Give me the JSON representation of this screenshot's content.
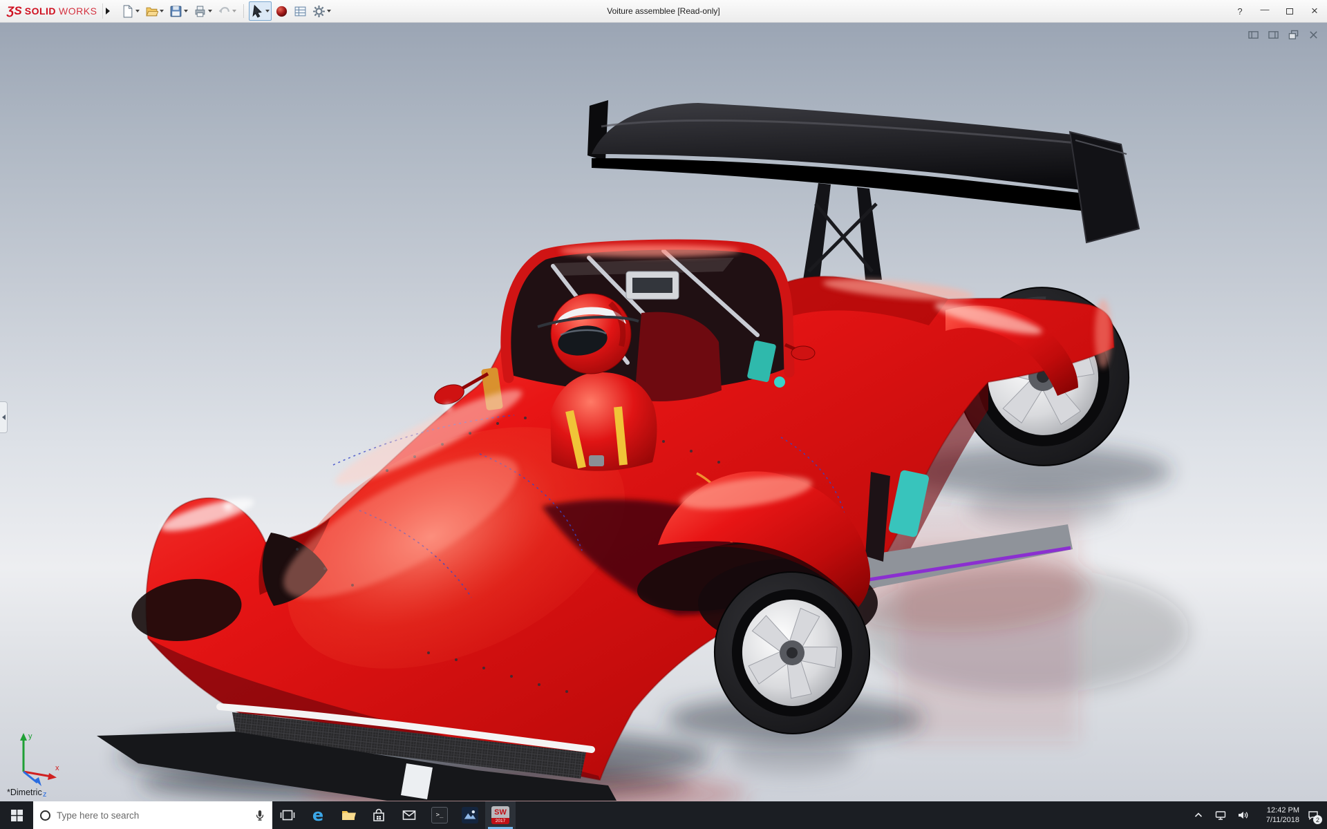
{
  "window": {
    "title": "Voiture assemblee [Read-only]",
    "help": "?",
    "minimize_glyph": "—",
    "close_glyph": "×"
  },
  "brand": {
    "mark": "ƷS",
    "bold": "SOLID",
    "light": "WORKS"
  },
  "toolbar": {
    "icons": [
      {
        "name": "new-document"
      },
      {
        "name": "open-document"
      },
      {
        "name": "save"
      },
      {
        "name": "print"
      },
      {
        "name": "undo"
      },
      {
        "name": "select-arrow",
        "pressed": true
      },
      {
        "name": "appearance-sphere"
      },
      {
        "name": "design-table"
      },
      {
        "name": "options-gear"
      }
    ]
  },
  "viewport": {
    "view_label": "*Dimetric",
    "triad": {
      "x": "x",
      "y": "y",
      "z": "z"
    },
    "model": {
      "body_color": "#e01212",
      "wing_color": "#121216",
      "accent_teal": "#38c4bc",
      "accent_purple": "#8b2fd0",
      "rim_color": "#d7d8dc"
    },
    "corner_icons": [
      {
        "name": "pane-left"
      },
      {
        "name": "pane-right"
      },
      {
        "name": "restore-window"
      },
      {
        "name": "close-window"
      }
    ]
  },
  "taskbar": {
    "search": {
      "placeholder": "Type here to search"
    },
    "apps": [
      {
        "name": "task-view"
      },
      {
        "name": "edge",
        "glyph": "e"
      },
      {
        "name": "file-explorer"
      },
      {
        "name": "store"
      },
      {
        "name": "mail"
      },
      {
        "name": "command-prompt",
        "glyph": "&gt;_"
      },
      {
        "name": "media-app"
      },
      {
        "name": "solidworks",
        "glyph": "SW",
        "year": "2017",
        "active": true
      }
    ],
    "tray": {
      "time": "12:42 PM",
      "date": "7/11/2018",
      "badge": "2"
    }
  }
}
